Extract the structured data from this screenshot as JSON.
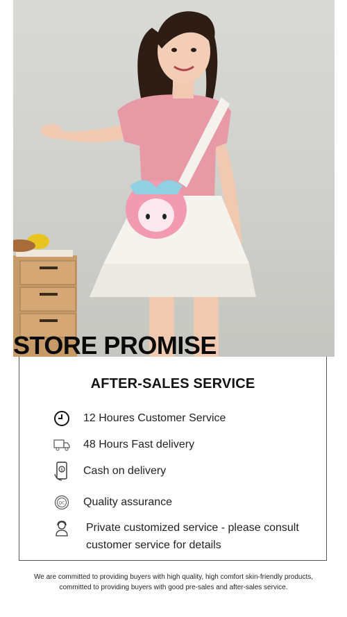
{
  "banner": {
    "title": "STORE PROMISE"
  },
  "service": {
    "heading": "AFTER-SALES SERVICE",
    "items": [
      {
        "icon": "clock-icon",
        "label": "12 Houres Customer Service"
      },
      {
        "icon": "delivery-truck-icon",
        "label": "48 Hours Fast delivery"
      },
      {
        "icon": "cash-phone-icon",
        "label": "Cash on delivery"
      },
      {
        "icon": "quality-badge-icon",
        "label": "Quality assurance"
      },
      {
        "icon": "customer-agent-icon",
        "label": "Private customized service - please consult customer service for details"
      }
    ]
  },
  "footer": {
    "note": "We are committed to providing buyers with high quality, high comfort skin-friendly products, committed to providing buyers with good pre-sales and after-sales service."
  },
  "colors": {
    "background": "#ffffff",
    "text": "#111111",
    "border": "#555555",
    "shirt": "#e79aa6",
    "skirt": "#f5f3ee"
  }
}
